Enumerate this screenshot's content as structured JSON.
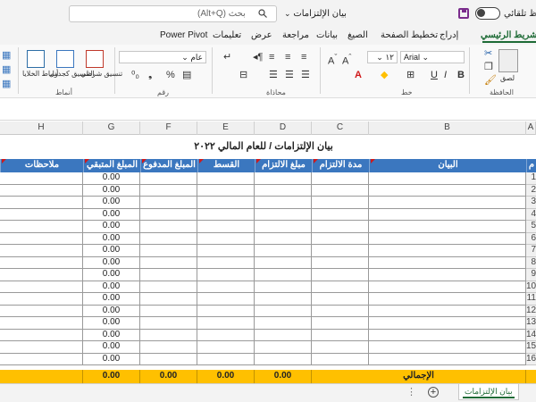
{
  "titlebar": {
    "autosave_label": "حفظ تلقائي",
    "doc_title": "بيان الإلتزامات",
    "search_placeholder": "بحث (Alt+Q)"
  },
  "tabs": [
    "الشريط الرئيسي",
    "إدراج",
    "تخطيط الصفحة",
    "الصيغ",
    "بيانات",
    "مراجعة",
    "عرض",
    "تعليمات",
    "Power Pivot"
  ],
  "active_tab": "الشريط الرئيسي",
  "ribbon": {
    "groups": [
      "الحافظة",
      "خط",
      "محاذاة",
      "رقم",
      "أنماط"
    ],
    "paste_label": "لصق",
    "font_name": "Arial",
    "font_size": "١٢",
    "number_format": "عام",
    "conditional_format_label": "تنسيق شرطي",
    "format_table_label": "التنسيق كجدول",
    "cell_styles_label": "أنماط الخلايا"
  },
  "columns": [
    "A",
    "B",
    "C",
    "D",
    "E",
    "F",
    "G",
    "H"
  ],
  "report_title": "بيان الإلتزامات / للعام المالي ٢٠٢٢",
  "table": {
    "headers": [
      "م",
      "البيان",
      "مدة الالتزام",
      "مبلغ الالتزام",
      "القسط الشهري",
      "المبلغ المدفوع",
      "المبلغ المتبقي",
      "ملاحظات"
    ],
    "row_numbers": [
      "1",
      "2",
      "3",
      "4",
      "5",
      "6",
      "7",
      "8",
      "9",
      "10",
      "11",
      "12",
      "13",
      "14",
      "15",
      "16"
    ],
    "remaining_values": [
      "0.00",
      "0.00",
      "0.00",
      "0.00",
      "0.00",
      "0.00",
      "0.00",
      "0.00",
      "0.00",
      "0.00",
      "0.00",
      "0.00",
      "0.00",
      "0.00",
      "0.00",
      "0.00"
    ],
    "total_label": "الإجمالي",
    "total_values": {
      "commitment_amount": "0.00",
      "monthly_installment": "0.00",
      "paid_amount": "0.00",
      "remaining_amount": "0.00"
    }
  },
  "sheet_tabs": [
    "بيان الإلتزامات"
  ],
  "colors": {
    "accent": "#1e6b36",
    "header_fill": "#3b77bf",
    "total_fill": "#ffc000"
  }
}
